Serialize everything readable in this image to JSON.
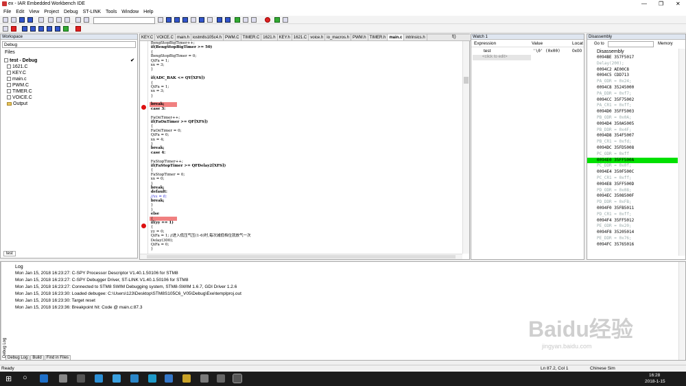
{
  "title": "ex - IAR Embedded Workbench IDE",
  "menu": [
    "File",
    "Edit",
    "View",
    "Project",
    "Debug",
    "ST-LINK",
    "Tools",
    "Window",
    "Help"
  ],
  "workspace": {
    "header": "Workspace",
    "config": "Debug",
    "files_label": "Files",
    "project": "test - Debug",
    "items": [
      "1621.C",
      "KEY.C",
      "main.c",
      "PWM.C",
      "TIMER.C",
      "VOICE.C",
      "Output"
    ],
    "bottom_tab": "test"
  },
  "editor": {
    "tabs": [
      "KEY.C",
      "VOICE.C",
      "main.h",
      "iostm8s105c4.h",
      "PWM.C",
      "TIMER.C",
      "1621.h",
      "KEY.h",
      "1621.C",
      "voice.h",
      "io_macros.h",
      "PWM.h",
      "TIMER.h",
      "main.c",
      "intrinsics.h"
    ],
    "active_tab": "main.c",
    "func": "f()",
    "lines": [
      " BengStopBigTimer++;",
      " if(BengStopBigTimer >= 50)",
      " {",
      " BengStopBigTimer = 0;",
      " QiFa = 1;",
      " xx = 3;",
      " }",
      "",
      " if(ADC_BAK <= QY[XFS])",
      " {",
      " QiFa = 1;",
      " xx = 3;",
      " }",
      "",
      " break;",
      " case 3:",
      "",
      " FaOnTimer++;",
      " if(FaOnTimer >= QF[XFS])",
      " {",
      " FaOnTimer = 0;",
      " QiFa = 0;",
      " xx = 4;",
      " }",
      " break;",
      " case 4:",
      "",
      " FaStopTimer++;",
      " if(FaStopTimer >= QFDelay2[XFS])",
      " {",
      " FaStopTimer = 0;",
      " xx = 0;",
      " }",
      " break;",
      " default:",
      " //xx = 0;",
      " break;",
      " }",
      " }",
      " else",
      " {",
      " if(yy == 1)",
      " {",
      " yy = 0;",
      " QiFa = 1; //进入低压气压(1-6)时,每次减低档位就放气一次",
      " Delay(300);",
      " QiFa = 0;",
      " }"
    ]
  },
  "watch": {
    "header": "Watch 1",
    "col_expr": "Expression",
    "col_value": "Value",
    "col_loc": "Locat",
    "rows": [
      {
        "expr": "test",
        "value": "'\\0' (0x00)",
        "loc": "0x00"
      }
    ],
    "placeholder": "<click to edit>"
  },
  "disasm": {
    "header": "Disassembly",
    "goto": "Go to",
    "memory": "Memory",
    "title": "Disassembly",
    "lines": [
      {
        "t": "0094BE 357F5017",
        "c": false,
        "pc": false
      },
      {
        "t": "Delay(200);",
        "c": true,
        "pc": false
      },
      {
        "t": "0094C2 AE00C8",
        "c": false,
        "pc": false
      },
      {
        "t": "0094C5 CDD713",
        "c": false,
        "pc": false
      },
      {
        "t": "PA_ODR = 0x24;",
        "c": true,
        "pc": false
      },
      {
        "t": "0094C8 35245000",
        "c": false,
        "pc": false
      },
      {
        "t": "PA_DDR = 0xf7;",
        "c": true,
        "pc": false
      },
      {
        "t": "0094CC 35F75002",
        "c": false,
        "pc": false
      },
      {
        "t": "PA_CR1 = 0xff;",
        "c": true,
        "pc": false
      },
      {
        "t": "0094D0 35FF5003",
        "c": false,
        "pc": false
      },
      {
        "t": "PB_ODR = 0x0A;",
        "c": true,
        "pc": false
      },
      {
        "t": "0094D4 350A5005",
        "c": false,
        "pc": false
      },
      {
        "t": "PB_DDR = 0x4F;",
        "c": true,
        "pc": false
      },
      {
        "t": "0094D8 354F5007",
        "c": false,
        "pc": false
      },
      {
        "t": "PB_CR1 = 0xfd;",
        "c": true,
        "pc": false
      },
      {
        "t": "0094DC 35FD5008",
        "c": false,
        "pc": false
      },
      {
        "t": "PC_ODR = 0xff",
        "c": true,
        "pc": false
      },
      {
        "t": "0094E0 35FF500A",
        "c": false,
        "pc": true
      },
      {
        "t": "PC_DDR = 0x0f;",
        "c": true,
        "pc": false
      },
      {
        "t": "0094E4 350F500C",
        "c": false,
        "pc": false
      },
      {
        "t": "PC_CR1 = 0xff;",
        "c": true,
        "pc": false
      },
      {
        "t": "0094E8 35FF500D",
        "c": false,
        "pc": false
      },
      {
        "t": "PD_ODR = 0x08;",
        "c": true,
        "pc": false
      },
      {
        "t": "0094EC 3508500F",
        "c": false,
        "pc": false
      },
      {
        "t": "PD_DDR = 0xFB;",
        "c": true,
        "pc": false
      },
      {
        "t": "0094F0 35FB5011",
        "c": false,
        "pc": false
      },
      {
        "t": "PD_CR1 = 0xff;",
        "c": true,
        "pc": false
      },
      {
        "t": "0094F4 35FF5012",
        "c": false,
        "pc": false
      },
      {
        "t": "PE_ODR = 0x20;",
        "c": true,
        "pc": false
      },
      {
        "t": "0094F8 35205014",
        "c": false,
        "pc": false
      },
      {
        "t": "PE_DDR = 0x76;",
        "c": true,
        "pc": false
      },
      {
        "t": "0094FC 35765016",
        "c": false,
        "pc": false
      }
    ]
  },
  "log": {
    "title": "Log",
    "lines": [
      "Mon Jan 15, 2018 16:23:27: C-SPY Processor Descriptor V1.40.1.50106 for STM8",
      "Mon Jan 15, 2018 16:23:27: C-SPY Debugger Driver, ST-LINK V1.40.1.50106 for STM8",
      "Mon Jan 15, 2018 16:23:27: Connected to STM8 SWIM Debugging system, STM8-SWIM 1.6.7, GDI Driver 1.2.6",
      "Mon Jan 15, 2018 16:23:30: Loaded debugee: C:\\Users\\123\\Desktop\\STM8S105C6_V05\\Debug\\Exe\\templproj.out",
      "Mon Jan 15, 2018 16:23:30: Target reset",
      "Mon Jan 15, 2018 16:23:36: Breakpoint hit: Code @ main.c:87.3"
    ],
    "tabs": [
      "Debug Log",
      "Build",
      "Find in Files"
    ],
    "side_label": "Debug Log"
  },
  "status": {
    "left": "Ready",
    "pos": "Ln 87.2, Col 1",
    "ime": "Chinese Sim"
  },
  "clock": {
    "time": "16:28",
    "date": "2018-1-15"
  },
  "watermark": {
    "main": "Baidu经验",
    "url": "jingyan.baidu.com"
  }
}
